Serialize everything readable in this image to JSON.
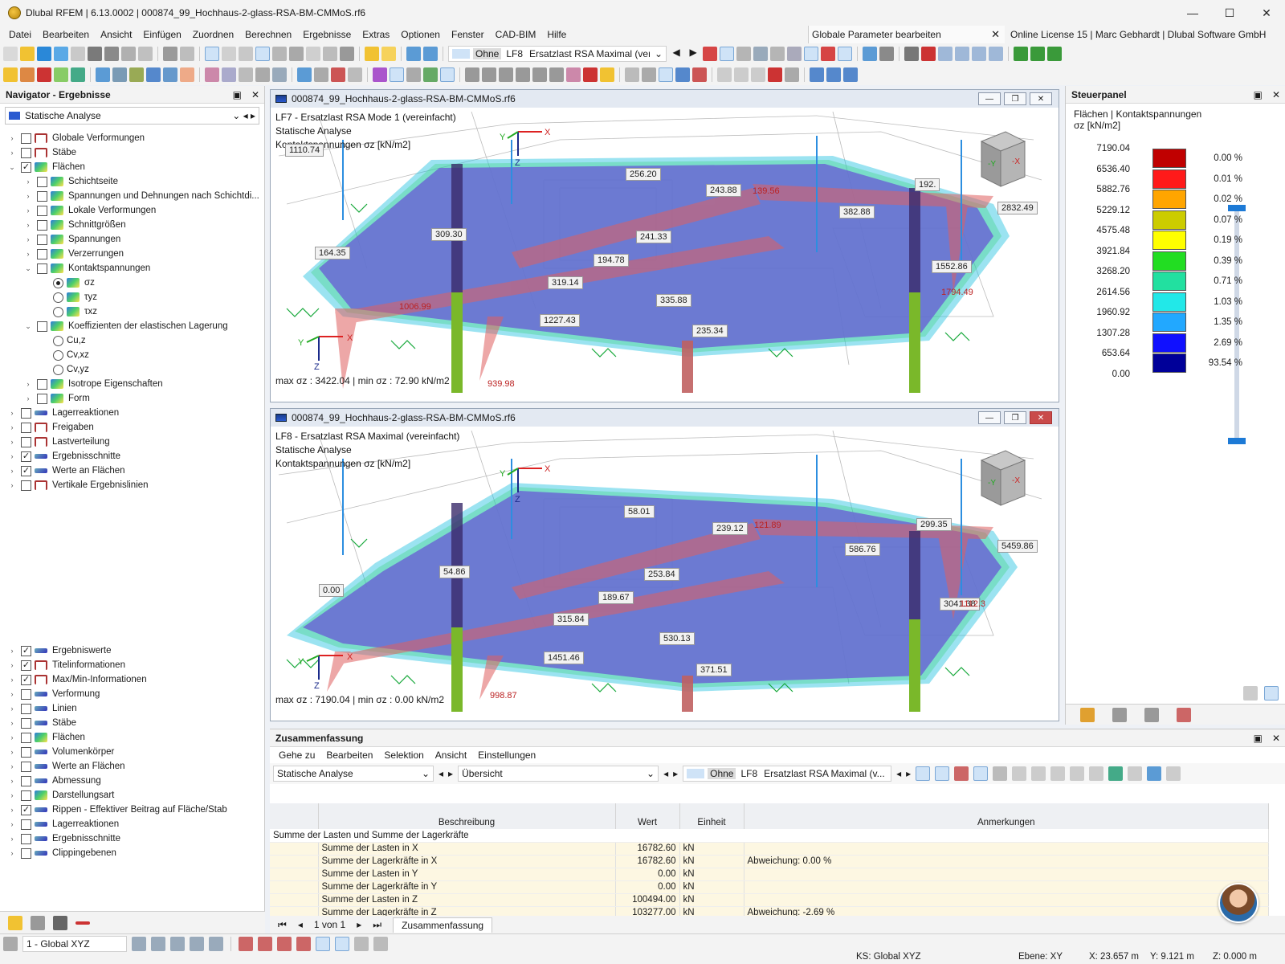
{
  "app": {
    "title": "Dlubal RFEM | 6.13.0002 | 000874_99_Hochhaus-2-glass-RSA-BM-CMMoS.rf6",
    "license": "Online License 15 | Marc Gebhardt | Dlubal Software GmbH",
    "global_params": "Globale Parameter bearbeiten"
  },
  "menu": [
    "Datei",
    "Bearbeiten",
    "Ansicht",
    "Einfügen",
    "Zuordnen",
    "Berechnen",
    "Ergebnisse",
    "Extras",
    "Optionen",
    "Fenster",
    "CAD-BIM",
    "Hilfe"
  ],
  "toolbar": {
    "loadcase_prefix": "Ohne",
    "loadcase_id": "LF8",
    "loadcase_name": "Ersatzlast RSA Maximal (ver..."
  },
  "navigator": {
    "title": "Navigator - Ergebnisse",
    "combo": "Statische Analyse",
    "tree_top": [
      {
        "label": "Globale Verformungen",
        "indent": 0,
        "expand": ">",
        "check": false,
        "icon": "frame"
      },
      {
        "label": "Stäbe",
        "indent": 0,
        "expand": ">",
        "check": false,
        "icon": "frame"
      },
      {
        "label": "Flächen",
        "indent": 0,
        "expand": "v",
        "check": true,
        "icon": "surf"
      },
      {
        "label": "Schichtseite",
        "indent": 1,
        "expand": ">",
        "check": false,
        "icon": "surf"
      },
      {
        "label": "Spannungen und Dehnungen nach Schichtdi...",
        "indent": 1,
        "expand": ">",
        "check": false,
        "icon": "surf"
      },
      {
        "label": "Lokale Verformungen",
        "indent": 1,
        "expand": ">",
        "check": false,
        "icon": "surf"
      },
      {
        "label": "Schnittgrößen",
        "indent": 1,
        "expand": ">",
        "check": false,
        "icon": "surf"
      },
      {
        "label": "Spannungen",
        "indent": 1,
        "expand": ">",
        "check": false,
        "icon": "surf"
      },
      {
        "label": "Verzerrungen",
        "indent": 1,
        "expand": ">",
        "check": false,
        "icon": "surf"
      },
      {
        "label": "Kontaktspannungen",
        "indent": 1,
        "expand": "v",
        "check": false,
        "icon": "surf"
      },
      {
        "label": "σz",
        "indent": 2,
        "radio": true,
        "on": true,
        "icon": "surf"
      },
      {
        "label": "τyz",
        "indent": 2,
        "radio": true,
        "on": false,
        "icon": "surf"
      },
      {
        "label": "τxz",
        "indent": 2,
        "radio": true,
        "on": false,
        "icon": "surf"
      },
      {
        "label": "Koeffizienten der elastischen Lagerung",
        "indent": 1,
        "expand": "v",
        "check": false,
        "icon": "surf"
      },
      {
        "label": "Cu,z",
        "indent": 2,
        "radio": true,
        "on": false,
        "icon": "none"
      },
      {
        "label": "Cv,xz",
        "indent": 2,
        "radio": true,
        "on": false,
        "icon": "none"
      },
      {
        "label": "Cv,yz",
        "indent": 2,
        "radio": true,
        "on": false,
        "icon": "none"
      },
      {
        "label": "Isotrope Eigenschaften",
        "indent": 1,
        "expand": ">",
        "check": false,
        "icon": "surf"
      },
      {
        "label": "Form",
        "indent": 1,
        "expand": ">",
        "check": false,
        "icon": "surf"
      },
      {
        "label": "Lagerreaktionen",
        "indent": 0,
        "expand": ">",
        "check": false,
        "icon": "curve"
      },
      {
        "label": "Freigaben",
        "indent": 0,
        "expand": ">",
        "check": false,
        "icon": "frame"
      },
      {
        "label": "Lastverteilung",
        "indent": 0,
        "expand": ">",
        "check": false,
        "icon": "frame"
      },
      {
        "label": "Ergebnisschnitte",
        "indent": 0,
        "expand": ">",
        "check": true,
        "icon": "curve"
      },
      {
        "label": "Werte an Flächen",
        "indent": 0,
        "expand": ">",
        "check": true,
        "icon": "curve"
      },
      {
        "label": "Vertikale Ergebnislinien",
        "indent": 0,
        "expand": ">",
        "check": false,
        "icon": "frame"
      }
    ],
    "tree_bottom": [
      {
        "label": "Ergebniswerte",
        "check": true,
        "icon": "curve"
      },
      {
        "label": "Titelinformationen",
        "check": true,
        "icon": "frame"
      },
      {
        "label": "Max/Min-Informationen",
        "check": true,
        "icon": "frame"
      },
      {
        "label": "Verformung",
        "check": false,
        "icon": "curve"
      },
      {
        "label": "Linien",
        "check": false,
        "icon": "curve"
      },
      {
        "label": "Stäbe",
        "check": false,
        "icon": "curve"
      },
      {
        "label": "Flächen",
        "check": false,
        "icon": "surf"
      },
      {
        "label": "Volumenkörper",
        "check": false,
        "icon": "curve"
      },
      {
        "label": "Werte an Flächen",
        "check": false,
        "icon": "curve"
      },
      {
        "label": "Abmessung",
        "check": false,
        "icon": "curve"
      },
      {
        "label": "Darstellungsart",
        "check": false,
        "icon": "surf"
      },
      {
        "label": "Rippen - Effektiver Beitrag auf Fläche/Stab",
        "check": true,
        "icon": "curve"
      },
      {
        "label": "Lagerreaktionen",
        "check": false,
        "icon": "curve"
      },
      {
        "label": "Ergebnisschnitte",
        "check": false,
        "icon": "curve"
      },
      {
        "label": "Clippingebenen",
        "check": false,
        "icon": "curve"
      }
    ]
  },
  "viewport1": {
    "file": "000874_99_Hochhaus-2-glass-RSA-BM-CMMoS.rf6",
    "line1": "LF7 - Ersatzlast RSA Mode 1 (vereinfacht)",
    "line2": "Statische Analyse",
    "line3": "Kontaktspannungen σz [kN/m2]",
    "maxmin": "max σz : 3422.04 | min σz : 72.90 kN/m2",
    "labels": [
      "1110.74",
      "256.20",
      "243.88",
      "192.",
      "2832.49",
      "382.88",
      "309.30",
      "241.33",
      "164.35",
      "194.78",
      "1552.86",
      "319.14",
      "335.88",
      "1227.43",
      "235.34"
    ],
    "red_labels": [
      "139.56",
      "1794.49",
      "939.98",
      "1006.99"
    ]
  },
  "viewport2": {
    "file": "000874_99_Hochhaus-2-glass-RSA-BM-CMMoS.rf6",
    "line1": "LF8 - Ersatzlast RSA Maximal (vereinfacht)",
    "line2": "Statische Analyse",
    "line3": "Kontaktspannungen σz [kN/m2]",
    "maxmin": "max σz : 7190.04 | min σz : 0.00 kN/m2",
    "labels": [
      "58.01",
      "239.12",
      "299.35",
      "5459.86",
      "586.76",
      "54.86",
      "0.00",
      "253.84",
      "189.67",
      "3041.38",
      "315.84",
      "530.13",
      "1451.46",
      "371.51"
    ],
    "red_labels": [
      "121.89",
      "998.87",
      "1112.3"
    ]
  },
  "steuerpanel": {
    "title": "Steuerpanel",
    "sub1": "Flächen | Kontaktspannungen",
    "sub2": "σz [kN/m2]",
    "legend": [
      {
        "value": "7190.04",
        "pct": "0.00 %",
        "color": "#c00000"
      },
      {
        "value": "6536.40",
        "pct": "0.01 %",
        "color": "#ff1a1a"
      },
      {
        "value": "5882.76",
        "pct": "0.02 %",
        "color": "#ffa500"
      },
      {
        "value": "5229.12",
        "pct": "0.07 %",
        "color": "#cccc00"
      },
      {
        "value": "4575.48",
        "pct": "0.19 %",
        "color": "#ffff00"
      },
      {
        "value": "3921.84",
        "pct": "0.39 %",
        "color": "#22dd22"
      },
      {
        "value": "3268.20",
        "pct": "0.71 %",
        "color": "#22e0a0"
      },
      {
        "value": "2614.56",
        "pct": "1.03 %",
        "color": "#22e8e8"
      },
      {
        "value": "1960.92",
        "pct": "1.35 %",
        "color": "#22a8ff"
      },
      {
        "value": "1307.28",
        "pct": "2.69 %",
        "color": "#1010ff"
      },
      {
        "value": "653.64",
        "pct": "93.54 %",
        "color": "#000099"
      },
      {
        "value": "0.00",
        "pct": "",
        "color": ""
      }
    ]
  },
  "summary": {
    "title": "Zusammenfassung",
    "menu": [
      "Gehe zu",
      "Bearbeiten",
      "Selektion",
      "Ansicht",
      "Einstellungen"
    ],
    "combo1": "Statische Analyse",
    "combo2": "Übersicht",
    "lc_prefix": "Ohne",
    "lc_id": "LF8",
    "lc_name": "Ersatzlast RSA Maximal (v...",
    "columns": [
      "Beschreibung",
      "Wert",
      "Einheit",
      "Anmerkungen"
    ],
    "group": "Summe der Lasten und Summe der Lagerkräfte",
    "rows": [
      {
        "desc": "Summe der Lasten in X",
        "value": "16782.60",
        "unit": "kN",
        "note": ""
      },
      {
        "desc": "Summe der Lagerkräfte in X",
        "value": "16782.60",
        "unit": "kN",
        "note": "Abweichung: 0.00 %"
      },
      {
        "desc": "Summe der Lasten in Y",
        "value": "0.00",
        "unit": "kN",
        "note": ""
      },
      {
        "desc": "Summe der Lagerkräfte in Y",
        "value": "0.00",
        "unit": "kN",
        "note": ""
      },
      {
        "desc": "Summe der Lasten in Z",
        "value": "100494.00",
        "unit": "kN",
        "note": ""
      },
      {
        "desc": "Summe der Lagerkräfte in Z",
        "value": "103277.00",
        "unit": "kN",
        "note": "Abweichung: -2.69 %"
      }
    ],
    "pager": "1 von 1",
    "tab": "Zusammenfassung"
  },
  "statusbar": {
    "cs": "1 - Global XYZ",
    "ks": "KS: Global XYZ",
    "ebene": "Ebene: XY",
    "x": "X: 23.657 m",
    "y": "Y: 9.121 m",
    "z": "Z: 0.000 m"
  }
}
